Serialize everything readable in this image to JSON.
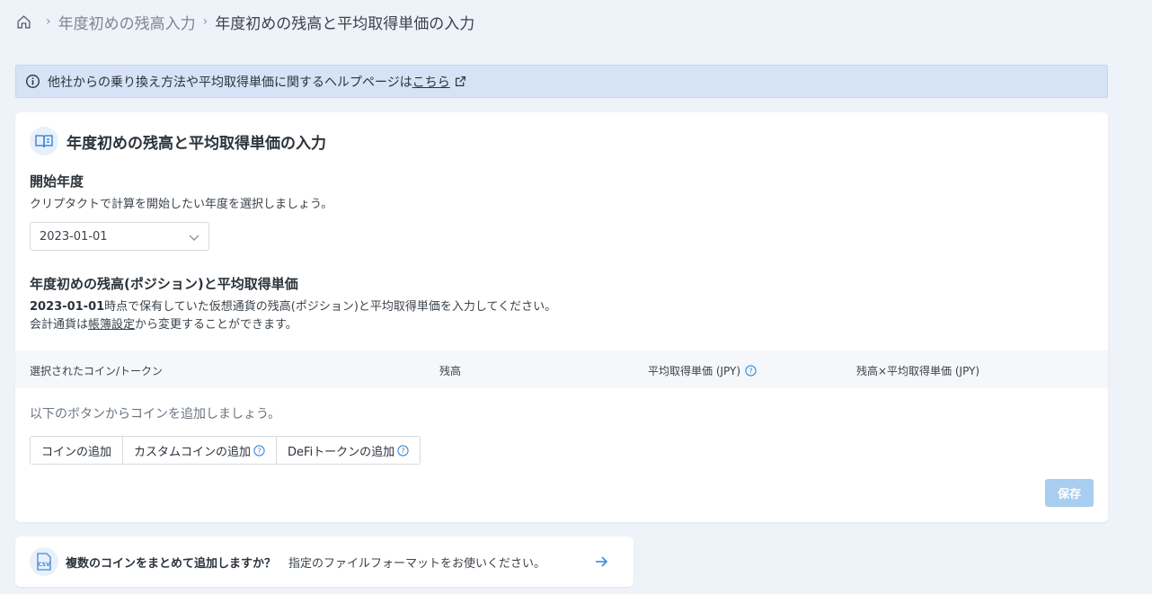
{
  "breadcrumb": {
    "home_icon": "home-icon",
    "items": [
      "年度初めの残高入力",
      "年度初めの残高と平均取得単価の入力"
    ]
  },
  "alert": {
    "text": "他社からの乗り換え方法や平均取得単価に関するヘルプページは",
    "link": "こちら",
    "icon": "info-icon"
  },
  "card": {
    "title": "年度初めの残高と平均取得単価の入力",
    "icon": "book-icon",
    "start_year": {
      "title": "開始年度",
      "desc": "クリプタクトで計算を開始したい年度を選択しましょう。",
      "selected": "2023-01-01"
    },
    "balance": {
      "title": "年度初めの残高(ポジション)と平均取得単価",
      "date": "2023-01-01",
      "desc1_rest": "時点で保有していた仮想通貨の残高(ポジション)と平均取得単価を入力してください。",
      "desc2_prefix": "会計通貨は",
      "desc2_link": "帳簿設定",
      "desc2_suffix": "から変更することができます。"
    },
    "table": {
      "columns": [
        "選択されたコイン/トークン",
        "残高",
        "平均取得単価 (JPY)",
        "残高×平均取得単価 (JPY)"
      ]
    },
    "empty_text": "以下のボタンからコインを追加しましょう。",
    "buttons": [
      "コインの追加",
      "カスタムコインの追加",
      "DeFiトークンの追加"
    ],
    "save": "保存"
  },
  "csv": {
    "badge": "CSV",
    "title": "複数のコインをまとめて追加しますか？",
    "desc": "指定のファイルフォーマットをお使いください。"
  },
  "colors": {
    "accent": "#3d8bd9",
    "save_disabled": "#a9cdef",
    "alert_bg": "#d6e3f7",
    "page_bg": "#eef2f9"
  }
}
